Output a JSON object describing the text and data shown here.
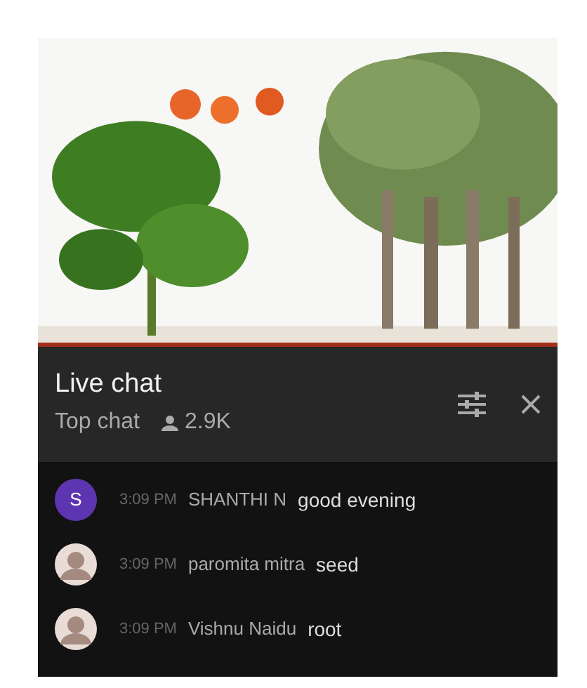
{
  "chat_header": {
    "title": "Live chat",
    "mode": "Top chat",
    "viewers": "2.9K"
  },
  "messages": [
    {
      "avatar": {
        "kind": "letter",
        "letter": "S",
        "color": "#5e35b1"
      },
      "time": "3:09 PM",
      "author": "SHANTHI N",
      "text": "good evening"
    },
    {
      "time": "3:09 PM",
      "author": "paromita mitra",
      "text": "seed"
    },
    {
      "time": "3:09 PM",
      "author": "Vishnu Naidu",
      "text": "root"
    }
  ]
}
